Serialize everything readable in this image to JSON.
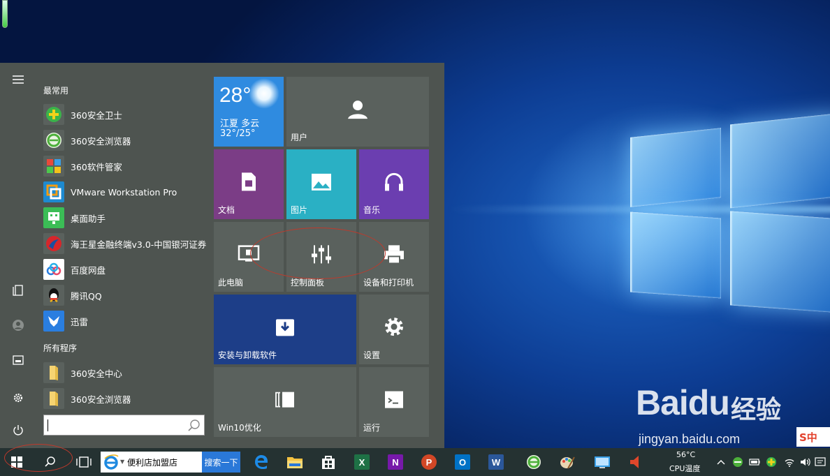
{
  "start_menu": {
    "rail": {
      "menu_icon": "hamburger-icon",
      "items": [
        "documents-icon",
        "user-icon",
        "pictures-icon",
        "settings-icon",
        "power-icon"
      ]
    },
    "most_used_header": "最常用",
    "most_used": [
      {
        "label": "360安全卫士",
        "icon": "360-safe-icon"
      },
      {
        "label": "360安全浏览器",
        "icon": "360-browser-icon"
      },
      {
        "label": "360软件管家",
        "icon": "360-software-manager-icon"
      },
      {
        "label": "VMware Workstation Pro",
        "icon": "vmware-icon"
      },
      {
        "label": "桌面助手",
        "icon": "desktop-helper-icon"
      },
      {
        "label": "海王星金融终端v3.0-中国银河证券",
        "icon": "neptune-finance-icon"
      },
      {
        "label": "百度网盘",
        "icon": "baidu-netdisk-icon"
      },
      {
        "label": "腾讯QQ",
        "icon": "qq-icon"
      },
      {
        "label": "迅雷",
        "icon": "xunlei-icon"
      }
    ],
    "all_programs_header": "所有程序",
    "all_programs": [
      {
        "label": "360安全中心",
        "icon": "folder-icon"
      },
      {
        "label": "360安全浏览器",
        "icon": "folder-icon"
      }
    ],
    "search": {
      "value": ""
    }
  },
  "tiles": {
    "weather": {
      "temp": "28°",
      "city": "江夏 多云",
      "range": "32°/25°"
    },
    "user": "用户",
    "documents": "文档",
    "pictures": "图片",
    "music": "音乐",
    "this_pc": "此电脑",
    "control_panel": "控制面板",
    "devices_printers": "设备和打印机",
    "install_uninstall": "安装与卸载软件",
    "settings": "设置",
    "win10_optimize": "Win10优化",
    "run": "运行"
  },
  "taskbar": {
    "ie_search_text": "便利店加盟店",
    "ie_search_button": "搜索一下",
    "cpu_temp_value": "56°C",
    "cpu_temp_label": "CPU温度",
    "apps": [
      "edge-icon",
      "file-explorer-icon",
      "store-icon",
      "excel-icon",
      "onenote-icon",
      "powerpoint-icon",
      "outlook-icon",
      "word-icon",
      "360-browser-icon",
      "paint-icon",
      "remote-desktop-icon",
      "speaker-app-icon"
    ]
  },
  "watermark": {
    "brand": "Baidu",
    "cn": "经验",
    "url": "jingyan.baidu.com",
    "sogou": "S中"
  },
  "colors": {
    "menu_bg": "#4e5450",
    "tile_gray": "#5a615d",
    "weather": "#2f8be0",
    "documents": "#7b3d86",
    "pictures": "#2ab0c4",
    "music": "#6b3eb0",
    "install": "#1d3e88",
    "taskbar": "#253232"
  }
}
